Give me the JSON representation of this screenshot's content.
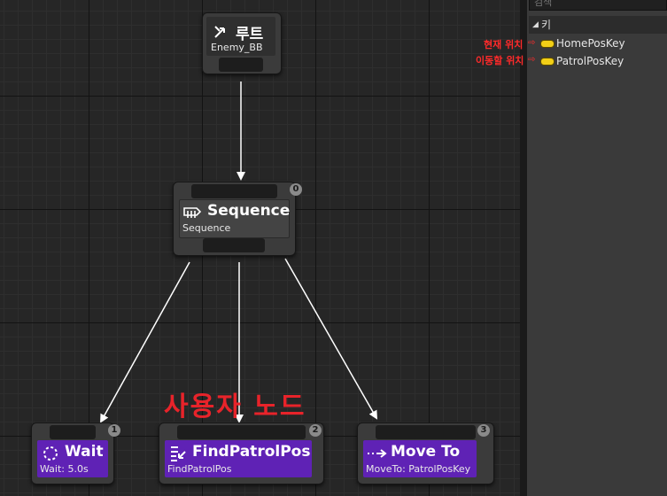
{
  "graph": {
    "annotation": "사용자 노드",
    "nodes": {
      "root": {
        "title": "루트",
        "subtitle": "Enemy_BB"
      },
      "sequence": {
        "title": "Sequence",
        "subtitle": "Sequence",
        "index": "0"
      },
      "wait": {
        "title": "Wait",
        "subtitle": "Wait: 5.0s",
        "index": "1"
      },
      "find": {
        "title": "FindPatrolPos",
        "subtitle": "FindPatrolPos",
        "index": "2"
      },
      "move": {
        "title": "Move To",
        "subtitle": "MoveTo: PatrolPosKey",
        "index": "3"
      }
    },
    "colors": {
      "task": "#5f22b5",
      "composite": "#444444",
      "wire": "#ffffff",
      "annotation": "#e8232a"
    }
  },
  "blackboard": {
    "search_placeholder": "검색",
    "category": "키",
    "keys": [
      {
        "label": "HomePosKey",
        "note": "현재 위치"
      },
      {
        "label": "PatrolPosKey",
        "note": "이동할 위치"
      }
    ],
    "key_color": "#f2cf17"
  }
}
